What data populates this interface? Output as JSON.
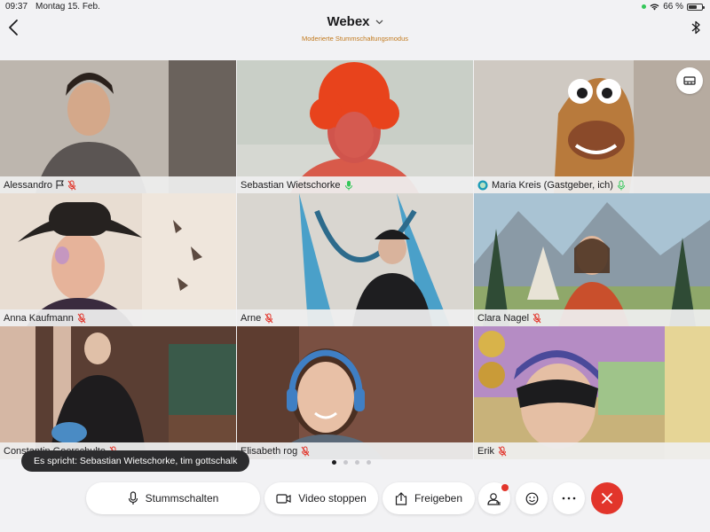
{
  "status_bar": {
    "time": "09:37",
    "date": "Montag 15. Feb.",
    "battery": "66 %",
    "battery_level": 0.66
  },
  "header": {
    "title": "Webex",
    "subtitle": "Moderierte Stummschaltungsmodus"
  },
  "participants": [
    {
      "name": "Alessandro",
      "mic": "muted",
      "flag": true
    },
    {
      "name": "Sebastian Wietschorke",
      "mic": "active",
      "speaking": true
    },
    {
      "name": "Maria Kreis (Gastgeber, ich)",
      "mic": "active",
      "host": true
    },
    {
      "name": "Anna Kaufmann",
      "mic": "muted"
    },
    {
      "name": "Arne",
      "mic": "muted"
    },
    {
      "name": "Clara Nagel",
      "mic": "muted"
    },
    {
      "name": "Constantin Goerschulte",
      "mic": "muted"
    },
    {
      "name": "Elisabeth rog",
      "mic": "muted"
    },
    {
      "name": "Erik",
      "mic": "muted"
    }
  ],
  "speaker_banner": "Es spricht: Sebastian Wietschorke, tim gottschalk",
  "pager": {
    "pages": 4,
    "current": 1
  },
  "toolbar": {
    "mute_label": "Stummschalten",
    "video_label": "Video stoppen",
    "share_label": "Freigeben"
  },
  "colors": {
    "accent": "#1e7fc9",
    "muted_red": "#e2352b",
    "active_green": "#34c759",
    "subtitle_orange": "#c27a1e"
  }
}
